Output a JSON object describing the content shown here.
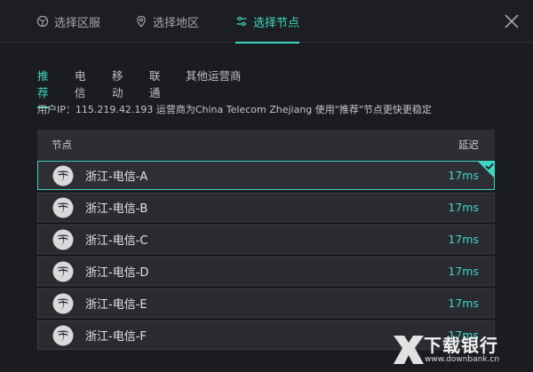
{
  "tabs": [
    {
      "label": "选择区服",
      "icon": "server-icon"
    },
    {
      "label": "选择地区",
      "icon": "location-pin-icon"
    },
    {
      "label": "选择节点",
      "icon": "sliders-icon",
      "active": true
    }
  ],
  "subtabs": [
    {
      "label": "推荐",
      "active": true
    },
    {
      "label": "电信"
    },
    {
      "label": "移动"
    },
    {
      "label": "联通"
    },
    {
      "label": "其他运营商"
    }
  ],
  "info_text": "用户IP：115.219.42.193  运营商为China Telecom Zhejiang  使用\"推荐\"节点更快更稳定",
  "table": {
    "col_node": "节点",
    "col_latency": "延迟"
  },
  "nodes": [
    {
      "name": "浙江-电信-A",
      "latency": "17ms",
      "selected": true
    },
    {
      "name": "浙江-电信-B",
      "latency": "17ms"
    },
    {
      "name": "浙江-电信-C",
      "latency": "17ms"
    },
    {
      "name": "浙江-电信-D",
      "latency": "17ms"
    },
    {
      "name": "浙江-电信-E",
      "latency": "17ms"
    },
    {
      "name": "浙江-电信-F",
      "latency": "17ms"
    }
  ],
  "watermark": {
    "text": "下载银行",
    "url": "www.downbank.cn"
  },
  "colors": {
    "accent": "#3fd6c5",
    "background": "#1b1c1f",
    "row": "#2a2b30"
  }
}
